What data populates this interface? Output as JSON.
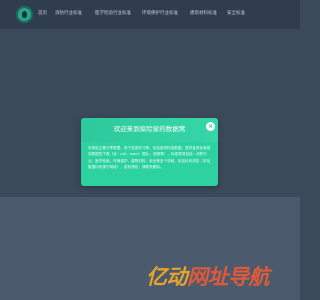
{
  "nav": {
    "items": [
      {
        "label": "首页"
      },
      {
        "label": "消防行业标准"
      },
      {
        "label": "医学检验行业标准"
      },
      {
        "label": "环境保护行业标准"
      },
      {
        "label": "建筑材料标准"
      },
      {
        "label": "安全标准"
      }
    ]
  },
  "modal": {
    "title": "欢迎来到探险家的数据窝",
    "close_icon": "×",
    "body": "本网站主要分享数据、用于查阅学习等，包括各类标准数据。提供各类标准规范数据的下载（含：pdf、word、图片、视频等），标准类别包括：消防行业、医学检验、环境保护、建筑材料、安全等多个领域，欢迎访问浏览（本站数据均来源于网络），若有侵权，请联系删除。",
    "accent_color": "#2ed1a0"
  },
  "watermark": {
    "text_a": "亿动",
    "text_b": "网址导航"
  }
}
